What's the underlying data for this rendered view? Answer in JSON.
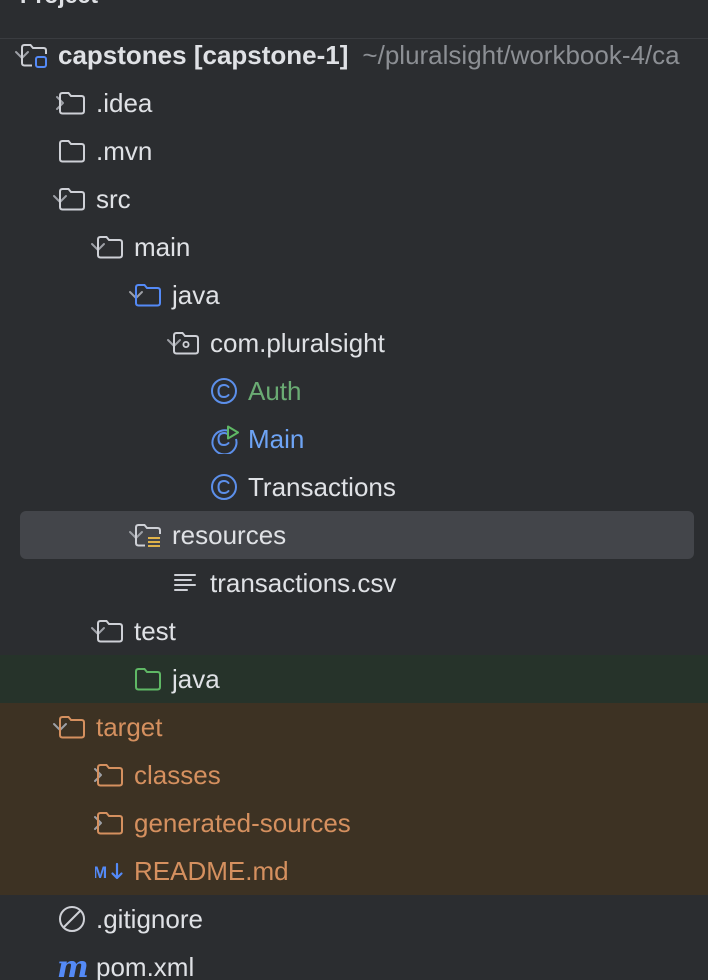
{
  "panel": {
    "title": "Project",
    "title_icon": "chevron-down-icon"
  },
  "colors": {
    "background": "#2b2d30",
    "text": "#dfe1e5",
    "path_gray": "#8c8f94",
    "test_bg": "#26332a",
    "excluded_bg": "#3d3223",
    "selection_bg": "#43454a",
    "green": "#6aab73",
    "blue": "#6ea4f5",
    "orange": "#d5905f",
    "class_icon": "#5c8fea"
  },
  "tree": [
    {
      "id": "capstones",
      "label": "capstones",
      "module": "[capstone-1]",
      "path": "~/pluralsight/workbook-4/ca",
      "icon": "module-folder-icon",
      "arrow": "expanded",
      "depth": 0
    },
    {
      "id": "idea",
      "label": ".idea",
      "icon": "folder-icon",
      "arrow": "collapsed",
      "depth": 1
    },
    {
      "id": "mvn",
      "label": ".mvn",
      "icon": "folder-icon",
      "arrow": "none",
      "depth": 1
    },
    {
      "id": "src",
      "label": "src",
      "icon": "folder-icon",
      "arrow": "expanded",
      "depth": 1
    },
    {
      "id": "main",
      "label": "main",
      "icon": "folder-icon",
      "arrow": "expanded",
      "depth": 2
    },
    {
      "id": "java-main",
      "label": "java",
      "icon": "source-folder-icon",
      "arrow": "expanded",
      "depth": 3
    },
    {
      "id": "package",
      "label": "com.pluralsight",
      "icon": "package-icon",
      "arrow": "expanded",
      "depth": 4
    },
    {
      "id": "auth",
      "label": "Auth",
      "icon": "class-icon",
      "arrow": "none",
      "depth": 5,
      "status": "added"
    },
    {
      "id": "main-class",
      "label": "Main",
      "icon": "main-class-icon",
      "arrow": "none",
      "depth": 5,
      "status": "modified"
    },
    {
      "id": "transactions",
      "label": "Transactions",
      "icon": "class-icon",
      "arrow": "none",
      "depth": 5
    },
    {
      "id": "resources",
      "label": "resources",
      "icon": "resources-folder-icon",
      "arrow": "expanded",
      "depth": 3,
      "selected": true
    },
    {
      "id": "csv",
      "label": "transactions.csv",
      "icon": "text-file-icon",
      "arrow": "none",
      "depth": 4
    },
    {
      "id": "test",
      "label": "test",
      "icon": "folder-icon",
      "arrow": "expanded",
      "depth": 2
    },
    {
      "id": "java-test",
      "label": "java",
      "icon": "test-folder-icon",
      "arrow": "none",
      "depth": 3,
      "highlight": "test"
    },
    {
      "id": "target",
      "label": "target",
      "icon": "excluded-folder-icon",
      "arrow": "expanded",
      "depth": 1,
      "highlight": "excluded"
    },
    {
      "id": "classes",
      "label": "classes",
      "icon": "excluded-folder-icon",
      "arrow": "collapsed",
      "depth": 2,
      "highlight": "excluded"
    },
    {
      "id": "generated",
      "label": "generated-sources",
      "icon": "excluded-folder-icon",
      "arrow": "collapsed",
      "depth": 2,
      "highlight": "excluded"
    },
    {
      "id": "readme",
      "label": "README.md",
      "icon": "markdown-icon",
      "arrow": "none",
      "depth": 2,
      "highlight": "excluded"
    },
    {
      "id": "gitignore",
      "label": ".gitignore",
      "icon": "ignore-file-icon",
      "arrow": "none",
      "depth": 1
    },
    {
      "id": "pom",
      "label": "pom.xml",
      "icon": "maven-icon",
      "arrow": "none",
      "depth": 1
    }
  ]
}
